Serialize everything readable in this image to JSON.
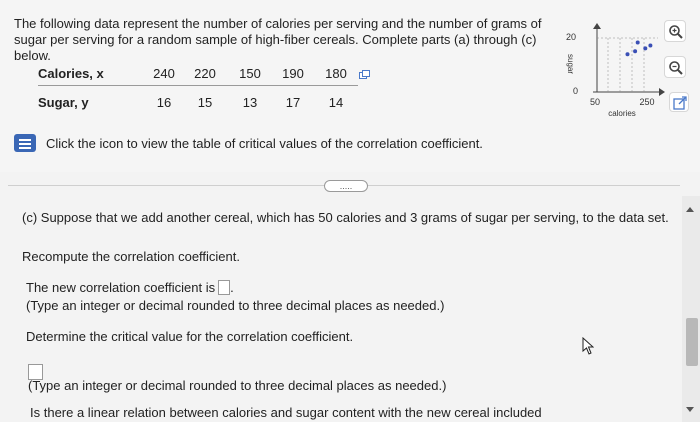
{
  "problem": {
    "intro": "The following data represent the number of calories per serving and the number of grams of sugar per serving for a random sample of high-fiber cereals. Complete parts (a) through (c) below."
  },
  "table": {
    "x_label": "Calories, x",
    "y_label": "Sugar, y",
    "x_values": [
      "240",
      "220",
      "150",
      "190",
      "180"
    ],
    "y_values": [
      "16",
      "15",
      "13",
      "17",
      "14"
    ]
  },
  "mini_chart": {
    "y_axis_label": "sugar",
    "x_axis_label": "calories",
    "y_ticks": [
      "20",
      "0"
    ],
    "x_ticks": [
      "50",
      "250"
    ],
    "points": [
      {
        "calories": 150,
        "sugar": 13
      },
      {
        "calories": 180,
        "sugar": 14
      },
      {
        "calories": 190,
        "sugar": 17
      },
      {
        "calories": 220,
        "sugar": 15
      },
      {
        "calories": 240,
        "sugar": 16
      }
    ],
    "x_range": [
      30,
      270
    ],
    "y_range": [
      0,
      22
    ],
    "accent": "#3a4fb5"
  },
  "hint": {
    "text": "Click the icon to view the table of critical values of the correlation coefficient."
  },
  "expander": {
    "label": "....."
  },
  "part_c": {
    "prompt": "(c) Suppose that we add another cereal, which has 50 calories and 3 grams of sugar per serving, to the data set.",
    "recompute": "Recompute the correlation coefficient.",
    "new_r_prefix": "The new correlation coefficient is",
    "new_r_suffix": ".",
    "format_hint_1": "(Type an integer or decimal rounded to three decimal places as needed.)",
    "critical_prompt": "Determine the critical value for the correlation coefficient.",
    "format_hint_2": "(Type an integer or decimal rounded to three decimal places as needed.)",
    "linear_question": "Is there a linear relation between calories and sugar content with the new cereal included"
  },
  "icons": {
    "zoom_in": "zoom-in-icon",
    "zoom_out": "zoom-out-icon",
    "popout": "popout-icon",
    "copy": "copy-icon",
    "hint": "table-icon"
  },
  "colors": {
    "accent_blue": "#3a67b5",
    "chart_points": "#3a4fb5"
  }
}
